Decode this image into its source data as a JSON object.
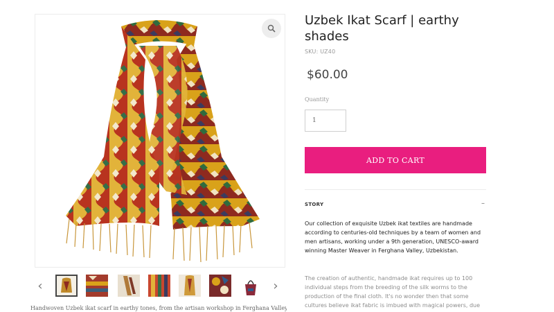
{
  "product": {
    "title": "Uzbek Ikat Scarf | earthy shades",
    "sku": "SKU: UZ40",
    "price": "$60.00",
    "quantity_label": "Quantity",
    "quantity_value": "1",
    "add_to_cart_label": "ADD TO CART"
  },
  "gallery": {
    "zoom_icon": "magnifier-icon",
    "prev_icon": "chevron-left-icon",
    "next_icon": "chevron-right-icon",
    "prev_symbol": "‹",
    "next_symbol": "›",
    "thumbnail_count": 7,
    "active_thumbnail": 1
  },
  "story": {
    "label": "STORY",
    "collapse_symbol": "–",
    "paragraph1": "Our collection of exquisite Uzbek ikat textiles are handmade according to centuries-old techniques by a team of women and men artisans, working under a 9th generation, UNESCO-award winning Master Weaver in Ferghana Valley, Uzbekistan.",
    "paragraph2": "The creation of authentic, handmade ikat requires up to 100 individual steps from the breeding of the silk worms to the production of the final cloth. It's no wonder then that some cultures believe ikat fabric is imbued with magical powers, due"
  },
  "description_below": "Handwoven Uzbek ikat scarf in earthy tones, from the artisan workshop in Ferghana Valley",
  "colors": {
    "accent": "#e91e7f",
    "border": "#ececec"
  }
}
